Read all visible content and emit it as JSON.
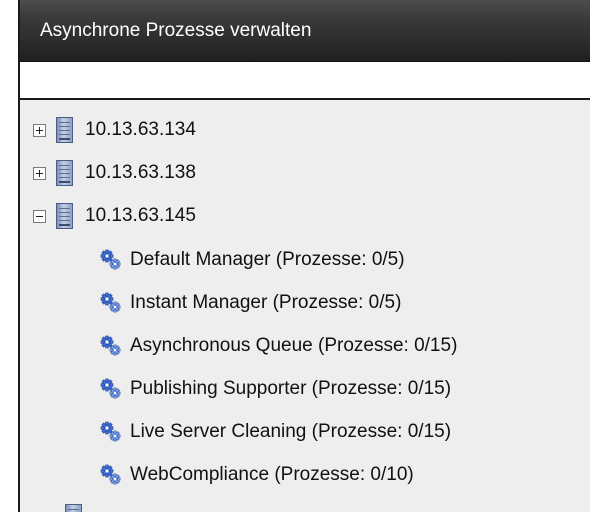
{
  "window": {
    "title": "Asynchrone Prozesse verwalten"
  },
  "tree": {
    "servers": [
      {
        "label": "10.13.63.134",
        "expanded": false
      },
      {
        "label": "10.13.63.138",
        "expanded": false
      },
      {
        "label": "10.13.63.145",
        "expanded": true
      }
    ],
    "managers": [
      {
        "label": "Default Manager (Prozesse: 0/5)"
      },
      {
        "label": "Instant Manager (Prozesse: 0/5)"
      },
      {
        "label": "Asynchronous Queue (Prozesse: 0/15)"
      },
      {
        "label": "Publishing Supporter (Prozesse: 0/15)"
      },
      {
        "label": "Live Server Cleaning (Prozesse: 0/15)"
      },
      {
        "label": "WebCompliance (Prozesse: 0/10)"
      }
    ]
  },
  "icons": {
    "expand": "plus-box-icon",
    "collapse": "minus-box-icon",
    "server": "server-icon",
    "manager": "gears-icon"
  }
}
